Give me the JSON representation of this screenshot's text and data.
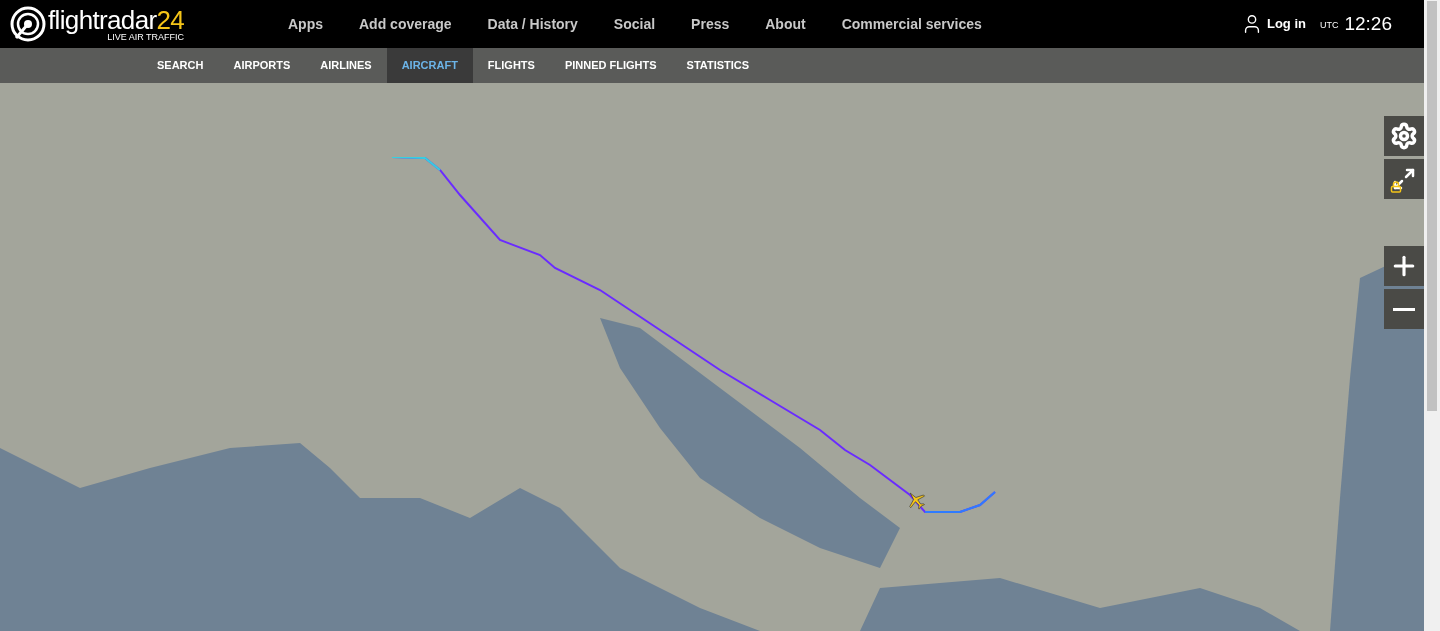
{
  "logo": {
    "name": "flightradar",
    "number": "24",
    "tagline": "LIVE AIR TRAFFIC"
  },
  "top_nav": [
    "Apps",
    "Add coverage",
    "Data / History",
    "Social",
    "Press",
    "About",
    "Commercial services"
  ],
  "login": "Log in",
  "clock": {
    "zone": "UTC",
    "time": "12:26"
  },
  "sub_nav": [
    {
      "label": "SEARCH",
      "selected": false
    },
    {
      "label": "AIRPORTS",
      "selected": false
    },
    {
      "label": "AIRLINES",
      "selected": false
    },
    {
      "label": "AIRCRAFT",
      "selected": true
    },
    {
      "label": "FLIGHTS",
      "selected": false
    },
    {
      "label": "PINNED FLIGHTS",
      "selected": false
    },
    {
      "label": "STATISTICS",
      "selected": false
    }
  ],
  "map_controls": [
    {
      "kind": "settings"
    },
    {
      "kind": "fullscreen",
      "locked": true
    },
    {
      "kind": "zoom_in"
    },
    {
      "kind": "zoom_out"
    }
  ]
}
